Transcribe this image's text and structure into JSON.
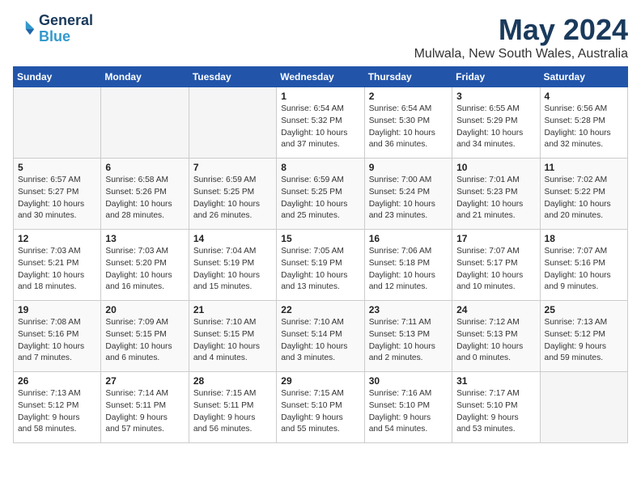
{
  "logo": {
    "line1": "General",
    "line2": "Blue"
  },
  "title": "May 2024",
  "location": "Mulwala, New South Wales, Australia",
  "days_of_week": [
    "Sunday",
    "Monday",
    "Tuesday",
    "Wednesday",
    "Thursday",
    "Friday",
    "Saturday"
  ],
  "weeks": [
    [
      {
        "day": "",
        "info": ""
      },
      {
        "day": "",
        "info": ""
      },
      {
        "day": "",
        "info": ""
      },
      {
        "day": "1",
        "info": "Sunrise: 6:54 AM\nSunset: 5:32 PM\nDaylight: 10 hours\nand 37 minutes."
      },
      {
        "day": "2",
        "info": "Sunrise: 6:54 AM\nSunset: 5:30 PM\nDaylight: 10 hours\nand 36 minutes."
      },
      {
        "day": "3",
        "info": "Sunrise: 6:55 AM\nSunset: 5:29 PM\nDaylight: 10 hours\nand 34 minutes."
      },
      {
        "day": "4",
        "info": "Sunrise: 6:56 AM\nSunset: 5:28 PM\nDaylight: 10 hours\nand 32 minutes."
      }
    ],
    [
      {
        "day": "5",
        "info": "Sunrise: 6:57 AM\nSunset: 5:27 PM\nDaylight: 10 hours\nand 30 minutes."
      },
      {
        "day": "6",
        "info": "Sunrise: 6:58 AM\nSunset: 5:26 PM\nDaylight: 10 hours\nand 28 minutes."
      },
      {
        "day": "7",
        "info": "Sunrise: 6:59 AM\nSunset: 5:25 PM\nDaylight: 10 hours\nand 26 minutes."
      },
      {
        "day": "8",
        "info": "Sunrise: 6:59 AM\nSunset: 5:25 PM\nDaylight: 10 hours\nand 25 minutes."
      },
      {
        "day": "9",
        "info": "Sunrise: 7:00 AM\nSunset: 5:24 PM\nDaylight: 10 hours\nand 23 minutes."
      },
      {
        "day": "10",
        "info": "Sunrise: 7:01 AM\nSunset: 5:23 PM\nDaylight: 10 hours\nand 21 minutes."
      },
      {
        "day": "11",
        "info": "Sunrise: 7:02 AM\nSunset: 5:22 PM\nDaylight: 10 hours\nand 20 minutes."
      }
    ],
    [
      {
        "day": "12",
        "info": "Sunrise: 7:03 AM\nSunset: 5:21 PM\nDaylight: 10 hours\nand 18 minutes."
      },
      {
        "day": "13",
        "info": "Sunrise: 7:03 AM\nSunset: 5:20 PM\nDaylight: 10 hours\nand 16 minutes."
      },
      {
        "day": "14",
        "info": "Sunrise: 7:04 AM\nSunset: 5:19 PM\nDaylight: 10 hours\nand 15 minutes."
      },
      {
        "day": "15",
        "info": "Sunrise: 7:05 AM\nSunset: 5:19 PM\nDaylight: 10 hours\nand 13 minutes."
      },
      {
        "day": "16",
        "info": "Sunrise: 7:06 AM\nSunset: 5:18 PM\nDaylight: 10 hours\nand 12 minutes."
      },
      {
        "day": "17",
        "info": "Sunrise: 7:07 AM\nSunset: 5:17 PM\nDaylight: 10 hours\nand 10 minutes."
      },
      {
        "day": "18",
        "info": "Sunrise: 7:07 AM\nSunset: 5:16 PM\nDaylight: 10 hours\nand 9 minutes."
      }
    ],
    [
      {
        "day": "19",
        "info": "Sunrise: 7:08 AM\nSunset: 5:16 PM\nDaylight: 10 hours\nand 7 minutes."
      },
      {
        "day": "20",
        "info": "Sunrise: 7:09 AM\nSunset: 5:15 PM\nDaylight: 10 hours\nand 6 minutes."
      },
      {
        "day": "21",
        "info": "Sunrise: 7:10 AM\nSunset: 5:15 PM\nDaylight: 10 hours\nand 4 minutes."
      },
      {
        "day": "22",
        "info": "Sunrise: 7:10 AM\nSunset: 5:14 PM\nDaylight: 10 hours\nand 3 minutes."
      },
      {
        "day": "23",
        "info": "Sunrise: 7:11 AM\nSunset: 5:13 PM\nDaylight: 10 hours\nand 2 minutes."
      },
      {
        "day": "24",
        "info": "Sunrise: 7:12 AM\nSunset: 5:13 PM\nDaylight: 10 hours\nand 0 minutes."
      },
      {
        "day": "25",
        "info": "Sunrise: 7:13 AM\nSunset: 5:12 PM\nDaylight: 9 hours\nand 59 minutes."
      }
    ],
    [
      {
        "day": "26",
        "info": "Sunrise: 7:13 AM\nSunset: 5:12 PM\nDaylight: 9 hours\nand 58 minutes."
      },
      {
        "day": "27",
        "info": "Sunrise: 7:14 AM\nSunset: 5:11 PM\nDaylight: 9 hours\nand 57 minutes."
      },
      {
        "day": "28",
        "info": "Sunrise: 7:15 AM\nSunset: 5:11 PM\nDaylight: 9 hours\nand 56 minutes."
      },
      {
        "day": "29",
        "info": "Sunrise: 7:15 AM\nSunset: 5:10 PM\nDaylight: 9 hours\nand 55 minutes."
      },
      {
        "day": "30",
        "info": "Sunrise: 7:16 AM\nSunset: 5:10 PM\nDaylight: 9 hours\nand 54 minutes."
      },
      {
        "day": "31",
        "info": "Sunrise: 7:17 AM\nSunset: 5:10 PM\nDaylight: 9 hours\nand 53 minutes."
      },
      {
        "day": "",
        "info": ""
      }
    ]
  ]
}
